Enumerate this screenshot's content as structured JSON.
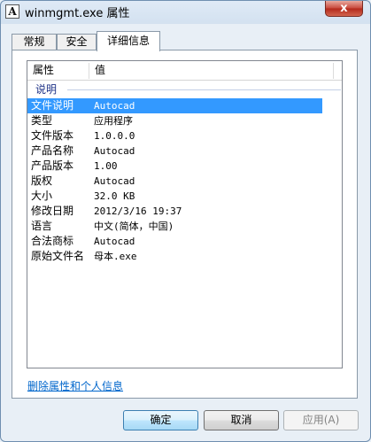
{
  "window": {
    "title": "winmgmt.exe 属性",
    "app_icon_glyph": "A",
    "close_glyph": "x"
  },
  "tabs": [
    {
      "label": "常规",
      "active": false
    },
    {
      "label": "安全",
      "active": false
    },
    {
      "label": "详细信息",
      "active": true
    }
  ],
  "list": {
    "headers": {
      "property": "属性",
      "value": "值"
    },
    "section_label": "说明",
    "rows": [
      {
        "property": "文件说明",
        "value": "Autocad",
        "selected": true
      },
      {
        "property": "类型",
        "value": "应用程序",
        "selected": false
      },
      {
        "property": "文件版本",
        "value": "1.0.0.0",
        "selected": false
      },
      {
        "property": "产品名称",
        "value": "Autocad",
        "selected": false
      },
      {
        "property": "产品版本",
        "value": "1.00",
        "selected": false
      },
      {
        "property": "版权",
        "value": "Autocad",
        "selected": false
      },
      {
        "property": "大小",
        "value": "32.0 KB",
        "selected": false
      },
      {
        "property": "修改日期",
        "value": "2012/3/16 19:37",
        "selected": false
      },
      {
        "property": "语言",
        "value": "中文(简体，中国)",
        "selected": false
      },
      {
        "property": "合法商标",
        "value": "Autocad",
        "selected": false
      },
      {
        "property": "原始文件名",
        "value": "母本.exe",
        "selected": false
      }
    ]
  },
  "remove_properties_link": "删除属性和个人信息",
  "buttons": {
    "ok": "确定",
    "cancel": "取消",
    "apply": "应用(A)"
  },
  "colors": {
    "selection": "#3399ff",
    "link": "#0066cc",
    "section_header": "#1e3287"
  }
}
